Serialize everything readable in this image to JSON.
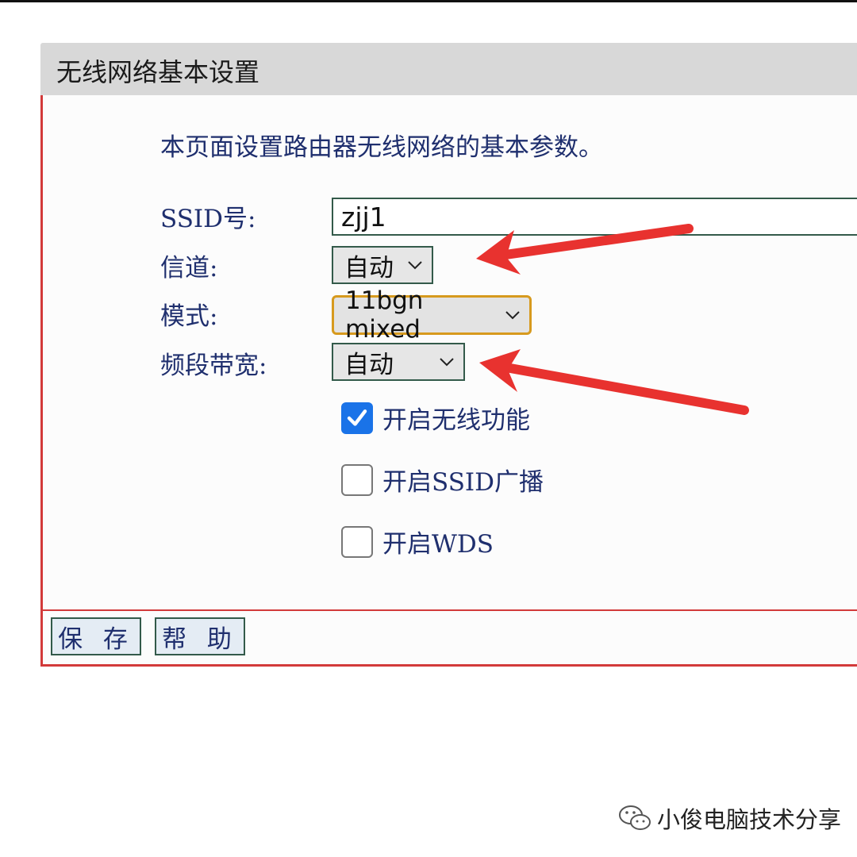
{
  "header": {
    "title": "无线网络基本设置"
  },
  "description": "本页面设置路由器无线网络的基本参数。",
  "fields": {
    "ssid": {
      "label": "SSID号:",
      "value": "zjj1"
    },
    "channel": {
      "label": "信道:",
      "value": "自动"
    },
    "mode": {
      "label": "模式:",
      "value": "11bgn mixed"
    },
    "bandwidth": {
      "label": "频段带宽:",
      "value": "自动"
    }
  },
  "checkboxes": [
    {
      "label": "开启无线功能",
      "checked": true
    },
    {
      "label": "开启SSID广播",
      "checked": false
    },
    {
      "label": "开启WDS",
      "checked": false
    }
  ],
  "buttons": {
    "save": "保 存",
    "help": "帮 助"
  },
  "watermark": {
    "text": "小俊电脑技术分享",
    "icon": "wechat-icon"
  },
  "colors": {
    "annotation_arrow": "#e8322f",
    "label_text": "#1f2f6e",
    "panel_border": "#d23a3a",
    "focus_ring": "#d79a1e",
    "checkbox_checked": "#1a73e8"
  }
}
